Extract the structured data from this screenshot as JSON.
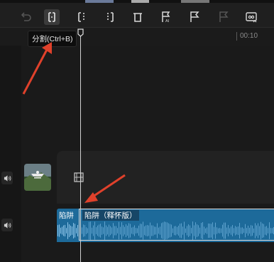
{
  "toolbar": {
    "tools": [
      {
        "icon": "undo-icon",
        "name": "undo"
      },
      {
        "icon": "split-icon",
        "name": "split",
        "active": true
      },
      {
        "icon": "split-left-icon",
        "name": "split-left"
      },
      {
        "icon": "split-right-icon",
        "name": "split-right"
      },
      {
        "icon": "delete-icon",
        "name": "delete"
      },
      {
        "icon": "marker-ai-icon",
        "name": "marker-ai"
      },
      {
        "icon": "flag-icon",
        "name": "flag"
      },
      {
        "icon": "flag-disabled-icon",
        "name": "flag-disabled"
      },
      {
        "icon": "audio-separate-icon",
        "name": "audio-separate"
      }
    ]
  },
  "tooltip": {
    "text": "分割(Ctrl+B)"
  },
  "ruler": {
    "label": "00:10"
  },
  "tracks": {
    "audio_clip_a": {
      "label": "陷阱"
    },
    "audio_clip_b": {
      "label": "陷阱（释怀版）"
    }
  },
  "colors": {
    "clip": "#1d6a9a",
    "annotation_arrow": "#e0412b",
    "playhead": "#d0d0d0"
  }
}
